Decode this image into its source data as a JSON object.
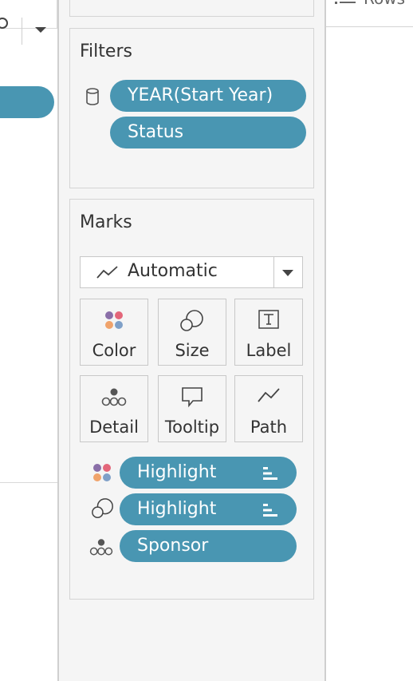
{
  "filters": {
    "title": "Filters",
    "pills": [
      "YEAR(Start Year)",
      "Status"
    ]
  },
  "marks": {
    "title": "Marks",
    "mark_type": "Automatic",
    "buttons": [
      "Color",
      "Size",
      "Label",
      "Detail",
      "Tooltip",
      "Path"
    ],
    "pills": [
      {
        "label": "Highlight",
        "encoding": "color",
        "sorted": true
      },
      {
        "label": "Highlight",
        "encoding": "size",
        "sorted": true
      },
      {
        "label": "Sponsor",
        "encoding": "detail",
        "sorted": false
      }
    ]
  },
  "rows_shelf": {
    "label": "Rows"
  },
  "colors": {
    "pill": "#4996b2",
    "panel": "#f5f5f5",
    "dots": [
      "#8a6fa8",
      "#e3667a",
      "#f0a36b",
      "#7fa0c8"
    ]
  }
}
